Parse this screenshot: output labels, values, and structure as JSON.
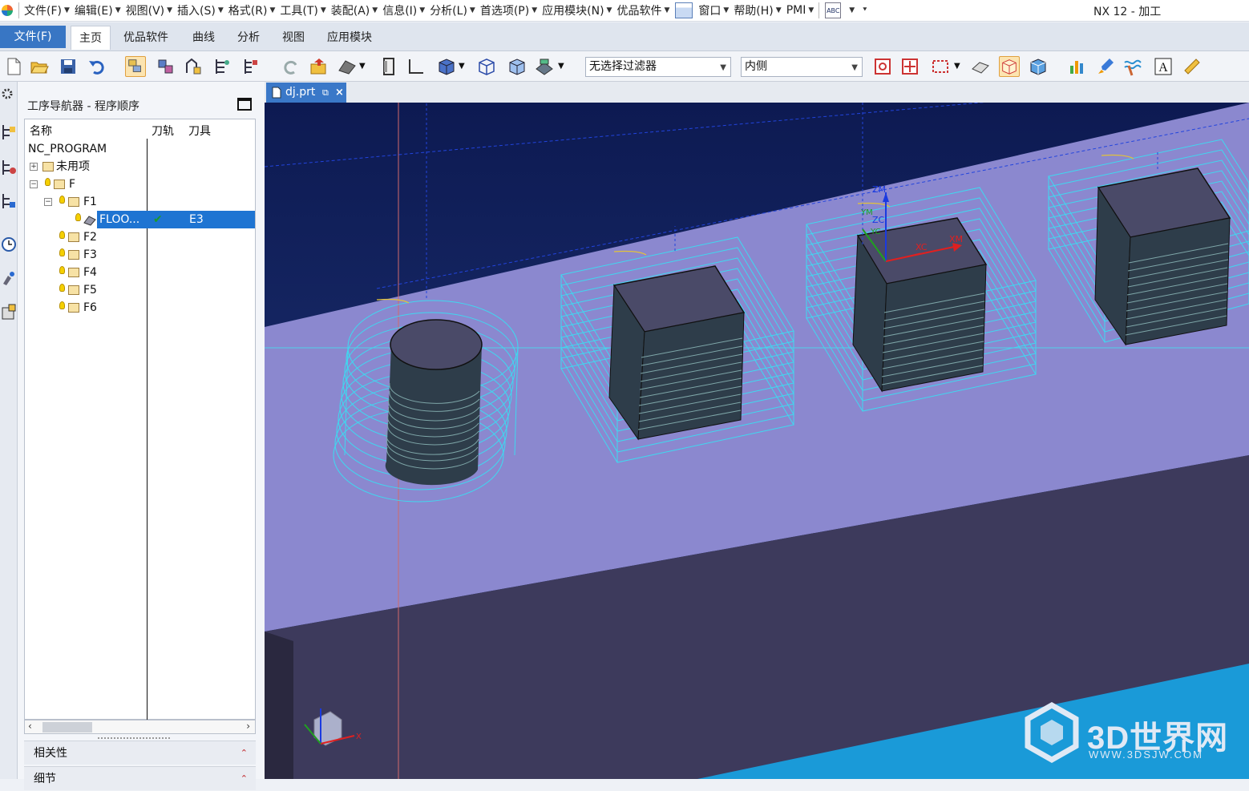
{
  "menubar": {
    "items": [
      {
        "label": "文件(F)"
      },
      {
        "label": "编辑(E)"
      },
      {
        "label": "视图(V)"
      },
      {
        "label": "插入(S)"
      },
      {
        "label": "格式(R)"
      },
      {
        "label": "工具(T)"
      },
      {
        "label": "装配(A)"
      },
      {
        "label": "信息(I)"
      },
      {
        "label": "分析(L)"
      },
      {
        "label": "首选项(P)"
      },
      {
        "label": "应用模块(N)"
      },
      {
        "label": "优品软件"
      },
      {
        "label": "窗口"
      },
      {
        "label": "帮助(H)"
      },
      {
        "label": "PMI"
      }
    ],
    "window_title": "NX 12 - 加工"
  },
  "ribbon": {
    "file_tab": "文件(F)",
    "tabs": [
      "主页",
      "优品软件",
      "曲线",
      "分析",
      "视图",
      "应用模块"
    ],
    "active_tab": "主页"
  },
  "toolbar": {
    "selection_filter": "无选择过滤器",
    "selection_scope": "内侧"
  },
  "navigator": {
    "title": "工序导航器 - 程序顺序",
    "columns": {
      "name": "名称",
      "toolpath": "刀轨",
      "tool": "刀具"
    },
    "rows": [
      {
        "label": "NC_PROGRAM"
      },
      {
        "label": "未用项"
      },
      {
        "label": "F"
      },
      {
        "label": "F1"
      },
      {
        "label": "FLOO...",
        "tool": "E3",
        "toolpath_status": "✔"
      },
      {
        "label": "F2"
      },
      {
        "label": "F3"
      },
      {
        "label": "F4"
      },
      {
        "label": "F5"
      },
      {
        "label": "F6"
      }
    ],
    "sections": [
      "相关性",
      "细节"
    ]
  },
  "document": {
    "tab_label": "dj.prt"
  },
  "viewport": {
    "axis_labels": {
      "zm": "ZM",
      "zc": "ZC",
      "xc": "XC",
      "xm": "XM",
      "yc": "YC",
      "ym": "YM"
    },
    "triad_x": "X"
  },
  "watermark": {
    "main": "3D世界网",
    "sub": "WWW.3DSJW.COM"
  },
  "colors": {
    "accent": "#3876c4",
    "selection": "#1e74d2",
    "viewport_top": "#0d1a52",
    "plate": "#8b88cf",
    "plate_side": "#3d3a5c",
    "toolpath": "#3fd8f0",
    "floor": "#1a9ad8"
  }
}
